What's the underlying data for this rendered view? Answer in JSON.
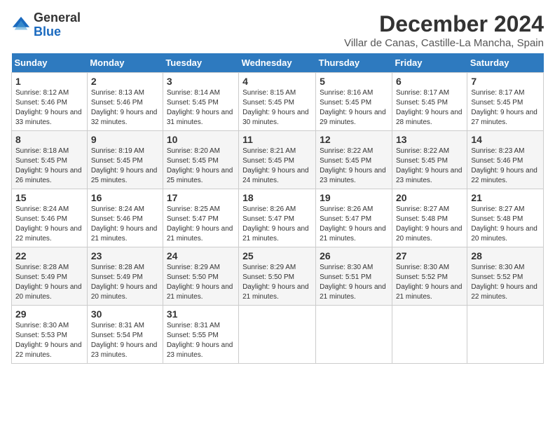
{
  "logo": {
    "general": "General",
    "blue": "Blue"
  },
  "title": "December 2024",
  "subtitle": "Villar de Canas, Castille-La Mancha, Spain",
  "headers": [
    "Sunday",
    "Monday",
    "Tuesday",
    "Wednesday",
    "Thursday",
    "Friday",
    "Saturday"
  ],
  "weeks": [
    [
      {
        "day": "1",
        "sunrise": "Sunrise: 8:12 AM",
        "sunset": "Sunset: 5:46 PM",
        "daylight": "Daylight: 9 hours and 33 minutes."
      },
      {
        "day": "2",
        "sunrise": "Sunrise: 8:13 AM",
        "sunset": "Sunset: 5:46 PM",
        "daylight": "Daylight: 9 hours and 32 minutes."
      },
      {
        "day": "3",
        "sunrise": "Sunrise: 8:14 AM",
        "sunset": "Sunset: 5:45 PM",
        "daylight": "Daylight: 9 hours and 31 minutes."
      },
      {
        "day": "4",
        "sunrise": "Sunrise: 8:15 AM",
        "sunset": "Sunset: 5:45 PM",
        "daylight": "Daylight: 9 hours and 30 minutes."
      },
      {
        "day": "5",
        "sunrise": "Sunrise: 8:16 AM",
        "sunset": "Sunset: 5:45 PM",
        "daylight": "Daylight: 9 hours and 29 minutes."
      },
      {
        "day": "6",
        "sunrise": "Sunrise: 8:17 AM",
        "sunset": "Sunset: 5:45 PM",
        "daylight": "Daylight: 9 hours and 28 minutes."
      },
      {
        "day": "7",
        "sunrise": "Sunrise: 8:17 AM",
        "sunset": "Sunset: 5:45 PM",
        "daylight": "Daylight: 9 hours and 27 minutes."
      }
    ],
    [
      {
        "day": "8",
        "sunrise": "Sunrise: 8:18 AM",
        "sunset": "Sunset: 5:45 PM",
        "daylight": "Daylight: 9 hours and 26 minutes."
      },
      {
        "day": "9",
        "sunrise": "Sunrise: 8:19 AM",
        "sunset": "Sunset: 5:45 PM",
        "daylight": "Daylight: 9 hours and 25 minutes."
      },
      {
        "day": "10",
        "sunrise": "Sunrise: 8:20 AM",
        "sunset": "Sunset: 5:45 PM",
        "daylight": "Daylight: 9 hours and 25 minutes."
      },
      {
        "day": "11",
        "sunrise": "Sunrise: 8:21 AM",
        "sunset": "Sunset: 5:45 PM",
        "daylight": "Daylight: 9 hours and 24 minutes."
      },
      {
        "day": "12",
        "sunrise": "Sunrise: 8:22 AM",
        "sunset": "Sunset: 5:45 PM",
        "daylight": "Daylight: 9 hours and 23 minutes."
      },
      {
        "day": "13",
        "sunrise": "Sunrise: 8:22 AM",
        "sunset": "Sunset: 5:45 PM",
        "daylight": "Daylight: 9 hours and 23 minutes."
      },
      {
        "day": "14",
        "sunrise": "Sunrise: 8:23 AM",
        "sunset": "Sunset: 5:46 PM",
        "daylight": "Daylight: 9 hours and 22 minutes."
      }
    ],
    [
      {
        "day": "15",
        "sunrise": "Sunrise: 8:24 AM",
        "sunset": "Sunset: 5:46 PM",
        "daylight": "Daylight: 9 hours and 22 minutes."
      },
      {
        "day": "16",
        "sunrise": "Sunrise: 8:24 AM",
        "sunset": "Sunset: 5:46 PM",
        "daylight": "Daylight: 9 hours and 21 minutes."
      },
      {
        "day": "17",
        "sunrise": "Sunrise: 8:25 AM",
        "sunset": "Sunset: 5:47 PM",
        "daylight": "Daylight: 9 hours and 21 minutes."
      },
      {
        "day": "18",
        "sunrise": "Sunrise: 8:26 AM",
        "sunset": "Sunset: 5:47 PM",
        "daylight": "Daylight: 9 hours and 21 minutes."
      },
      {
        "day": "19",
        "sunrise": "Sunrise: 8:26 AM",
        "sunset": "Sunset: 5:47 PM",
        "daylight": "Daylight: 9 hours and 21 minutes."
      },
      {
        "day": "20",
        "sunrise": "Sunrise: 8:27 AM",
        "sunset": "Sunset: 5:48 PM",
        "daylight": "Daylight: 9 hours and 20 minutes."
      },
      {
        "day": "21",
        "sunrise": "Sunrise: 8:27 AM",
        "sunset": "Sunset: 5:48 PM",
        "daylight": "Daylight: 9 hours and 20 minutes."
      }
    ],
    [
      {
        "day": "22",
        "sunrise": "Sunrise: 8:28 AM",
        "sunset": "Sunset: 5:49 PM",
        "daylight": "Daylight: 9 hours and 20 minutes."
      },
      {
        "day": "23",
        "sunrise": "Sunrise: 8:28 AM",
        "sunset": "Sunset: 5:49 PM",
        "daylight": "Daylight: 9 hours and 20 minutes."
      },
      {
        "day": "24",
        "sunrise": "Sunrise: 8:29 AM",
        "sunset": "Sunset: 5:50 PM",
        "daylight": "Daylight: 9 hours and 21 minutes."
      },
      {
        "day": "25",
        "sunrise": "Sunrise: 8:29 AM",
        "sunset": "Sunset: 5:50 PM",
        "daylight": "Daylight: 9 hours and 21 minutes."
      },
      {
        "day": "26",
        "sunrise": "Sunrise: 8:30 AM",
        "sunset": "Sunset: 5:51 PM",
        "daylight": "Daylight: 9 hours and 21 minutes."
      },
      {
        "day": "27",
        "sunrise": "Sunrise: 8:30 AM",
        "sunset": "Sunset: 5:52 PM",
        "daylight": "Daylight: 9 hours and 21 minutes."
      },
      {
        "day": "28",
        "sunrise": "Sunrise: 8:30 AM",
        "sunset": "Sunset: 5:52 PM",
        "daylight": "Daylight: 9 hours and 22 minutes."
      }
    ],
    [
      {
        "day": "29",
        "sunrise": "Sunrise: 8:30 AM",
        "sunset": "Sunset: 5:53 PM",
        "daylight": "Daylight: 9 hours and 22 minutes."
      },
      {
        "day": "30",
        "sunrise": "Sunrise: 8:31 AM",
        "sunset": "Sunset: 5:54 PM",
        "daylight": "Daylight: 9 hours and 23 minutes."
      },
      {
        "day": "31",
        "sunrise": "Sunrise: 8:31 AM",
        "sunset": "Sunset: 5:55 PM",
        "daylight": "Daylight: 9 hours and 23 minutes."
      },
      null,
      null,
      null,
      null
    ]
  ]
}
